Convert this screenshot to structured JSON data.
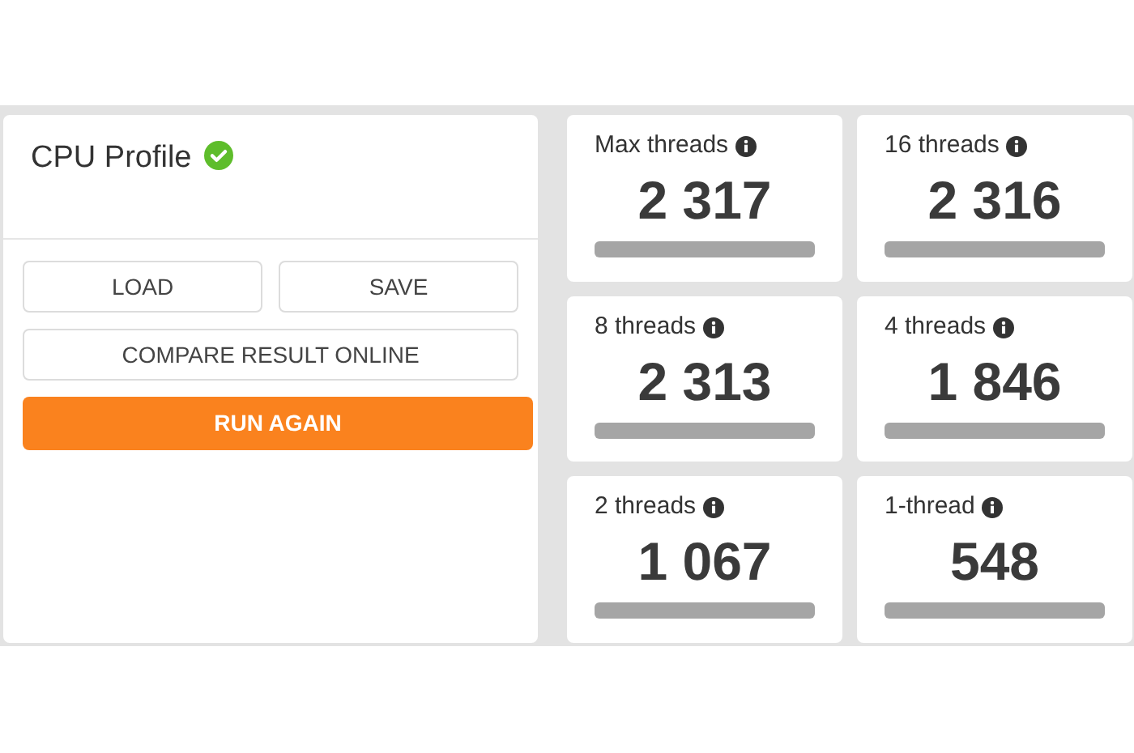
{
  "profile": {
    "title": "CPU Profile",
    "verified": true
  },
  "buttons": [
    {
      "label": "LOAD",
      "kind": "outline"
    },
    {
      "label": "SAVE",
      "kind": "outline"
    },
    {
      "label": "COMPARE RESULT ONLINE",
      "kind": "wide"
    },
    {
      "label": "RUN AGAIN",
      "kind": "primary"
    }
  ],
  "scores": [
    {
      "label": "Max threads",
      "value": "2 317"
    },
    {
      "label": "16 threads",
      "value": "2 316"
    },
    {
      "label": "8 threads",
      "value": "2 313"
    },
    {
      "label": "4 threads",
      "value": "1 846"
    },
    {
      "label": "2 threads",
      "value": "1 067"
    },
    {
      "label": "1-thread",
      "value": "548"
    }
  ]
}
